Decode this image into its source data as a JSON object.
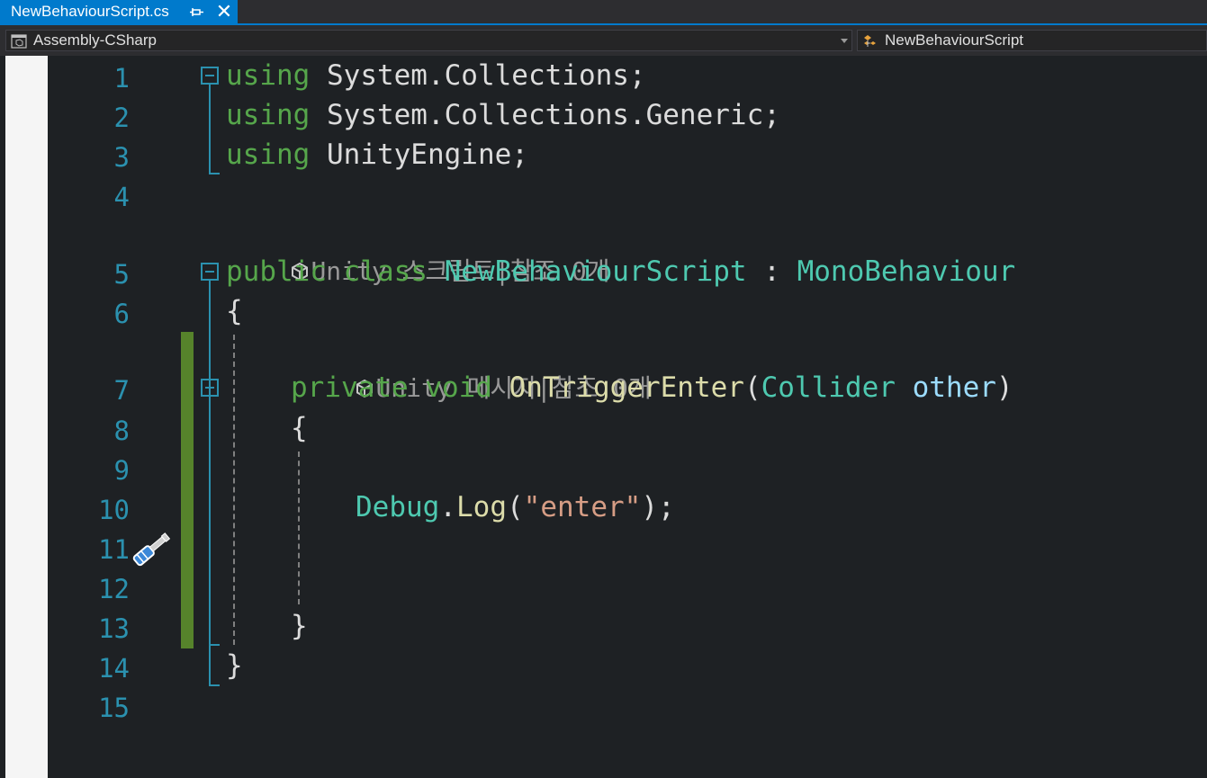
{
  "tab": {
    "title": "NewBehaviourScript.cs",
    "pin_icon": "pin-icon",
    "close_label": "✕"
  },
  "nav": {
    "project": "Assembly-CSharp",
    "class": "NewBehaviourScript"
  },
  "editor": {
    "line_numbers": [
      "1",
      "2",
      "3",
      "4",
      "5",
      "6",
      "7",
      "8",
      "9",
      "10",
      "11",
      "12",
      "13",
      "14",
      "15"
    ],
    "lines": {
      "l1": {
        "kw": "using",
        "rest": " System.Collections;"
      },
      "l2": {
        "kw": "using",
        "rest": " System.Collections.Generic;"
      },
      "l3": {
        "kw": "using",
        "rest": " UnityEngine;"
      },
      "lens1": "Unity 스크립트|참조 0개",
      "l5": {
        "kw1": "public",
        "kw2": " class ",
        "name": "NewBehaviourScript",
        "colon": " : ",
        "base": "MonoBehaviour"
      },
      "l6": "{",
      "lens2": "Unity 메시지|참조 0개",
      "l7": {
        "kw1": "private",
        "kw2": " void ",
        "fn": "OnTriggerEnter",
        "open": "(",
        "type": "Collider",
        "param": " other",
        "close": ")"
      },
      "l8": "{",
      "l10": {
        "cls": "Debug",
        "dot": ".",
        "fn": "Log",
        "open": "(",
        "str": "\"enter\"",
        "close": ");"
      },
      "l13": "}",
      "l14": "}"
    }
  },
  "colors": {
    "accent": "#007acc",
    "keyword": "#56a64b",
    "type": "#4ec9b0",
    "string": "#d69d85",
    "line_number": "#2b91af",
    "change_bar": "#56832b"
  }
}
